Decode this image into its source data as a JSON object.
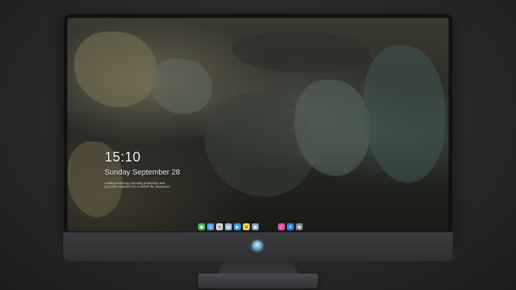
{
  "lockscreen": {
    "time": "15:10",
    "date": "Sunday September 28",
    "tagline_line1": "Leading technology, Elevating productivity. Mak",
    "tagline_line2": "your ideal companion for a smarter life. 3xxxxxxxxx"
  },
  "dock": {
    "left_icons": [
      {
        "name": "messages-icon",
        "color": "#39c450"
      },
      {
        "name": "finder-icon",
        "color": "#4e8de0"
      },
      {
        "name": "safari-icon",
        "color": "#d9d9d9"
      },
      {
        "name": "preview-icon",
        "color": "#8fb7d6"
      },
      {
        "name": "clapper-icon",
        "color": "#2f9fe0"
      },
      {
        "name": "notes-icon",
        "color": "#f4d54a"
      },
      {
        "name": "photos-icon",
        "color": "#7aa8c9"
      }
    ],
    "right_icons": [
      {
        "name": "music-icon",
        "color": "#e34fa5"
      },
      {
        "name": "appstore-icon",
        "color": "#2a84f0"
      },
      {
        "name": "camera-icon",
        "color": "#8a8a8a"
      }
    ]
  }
}
